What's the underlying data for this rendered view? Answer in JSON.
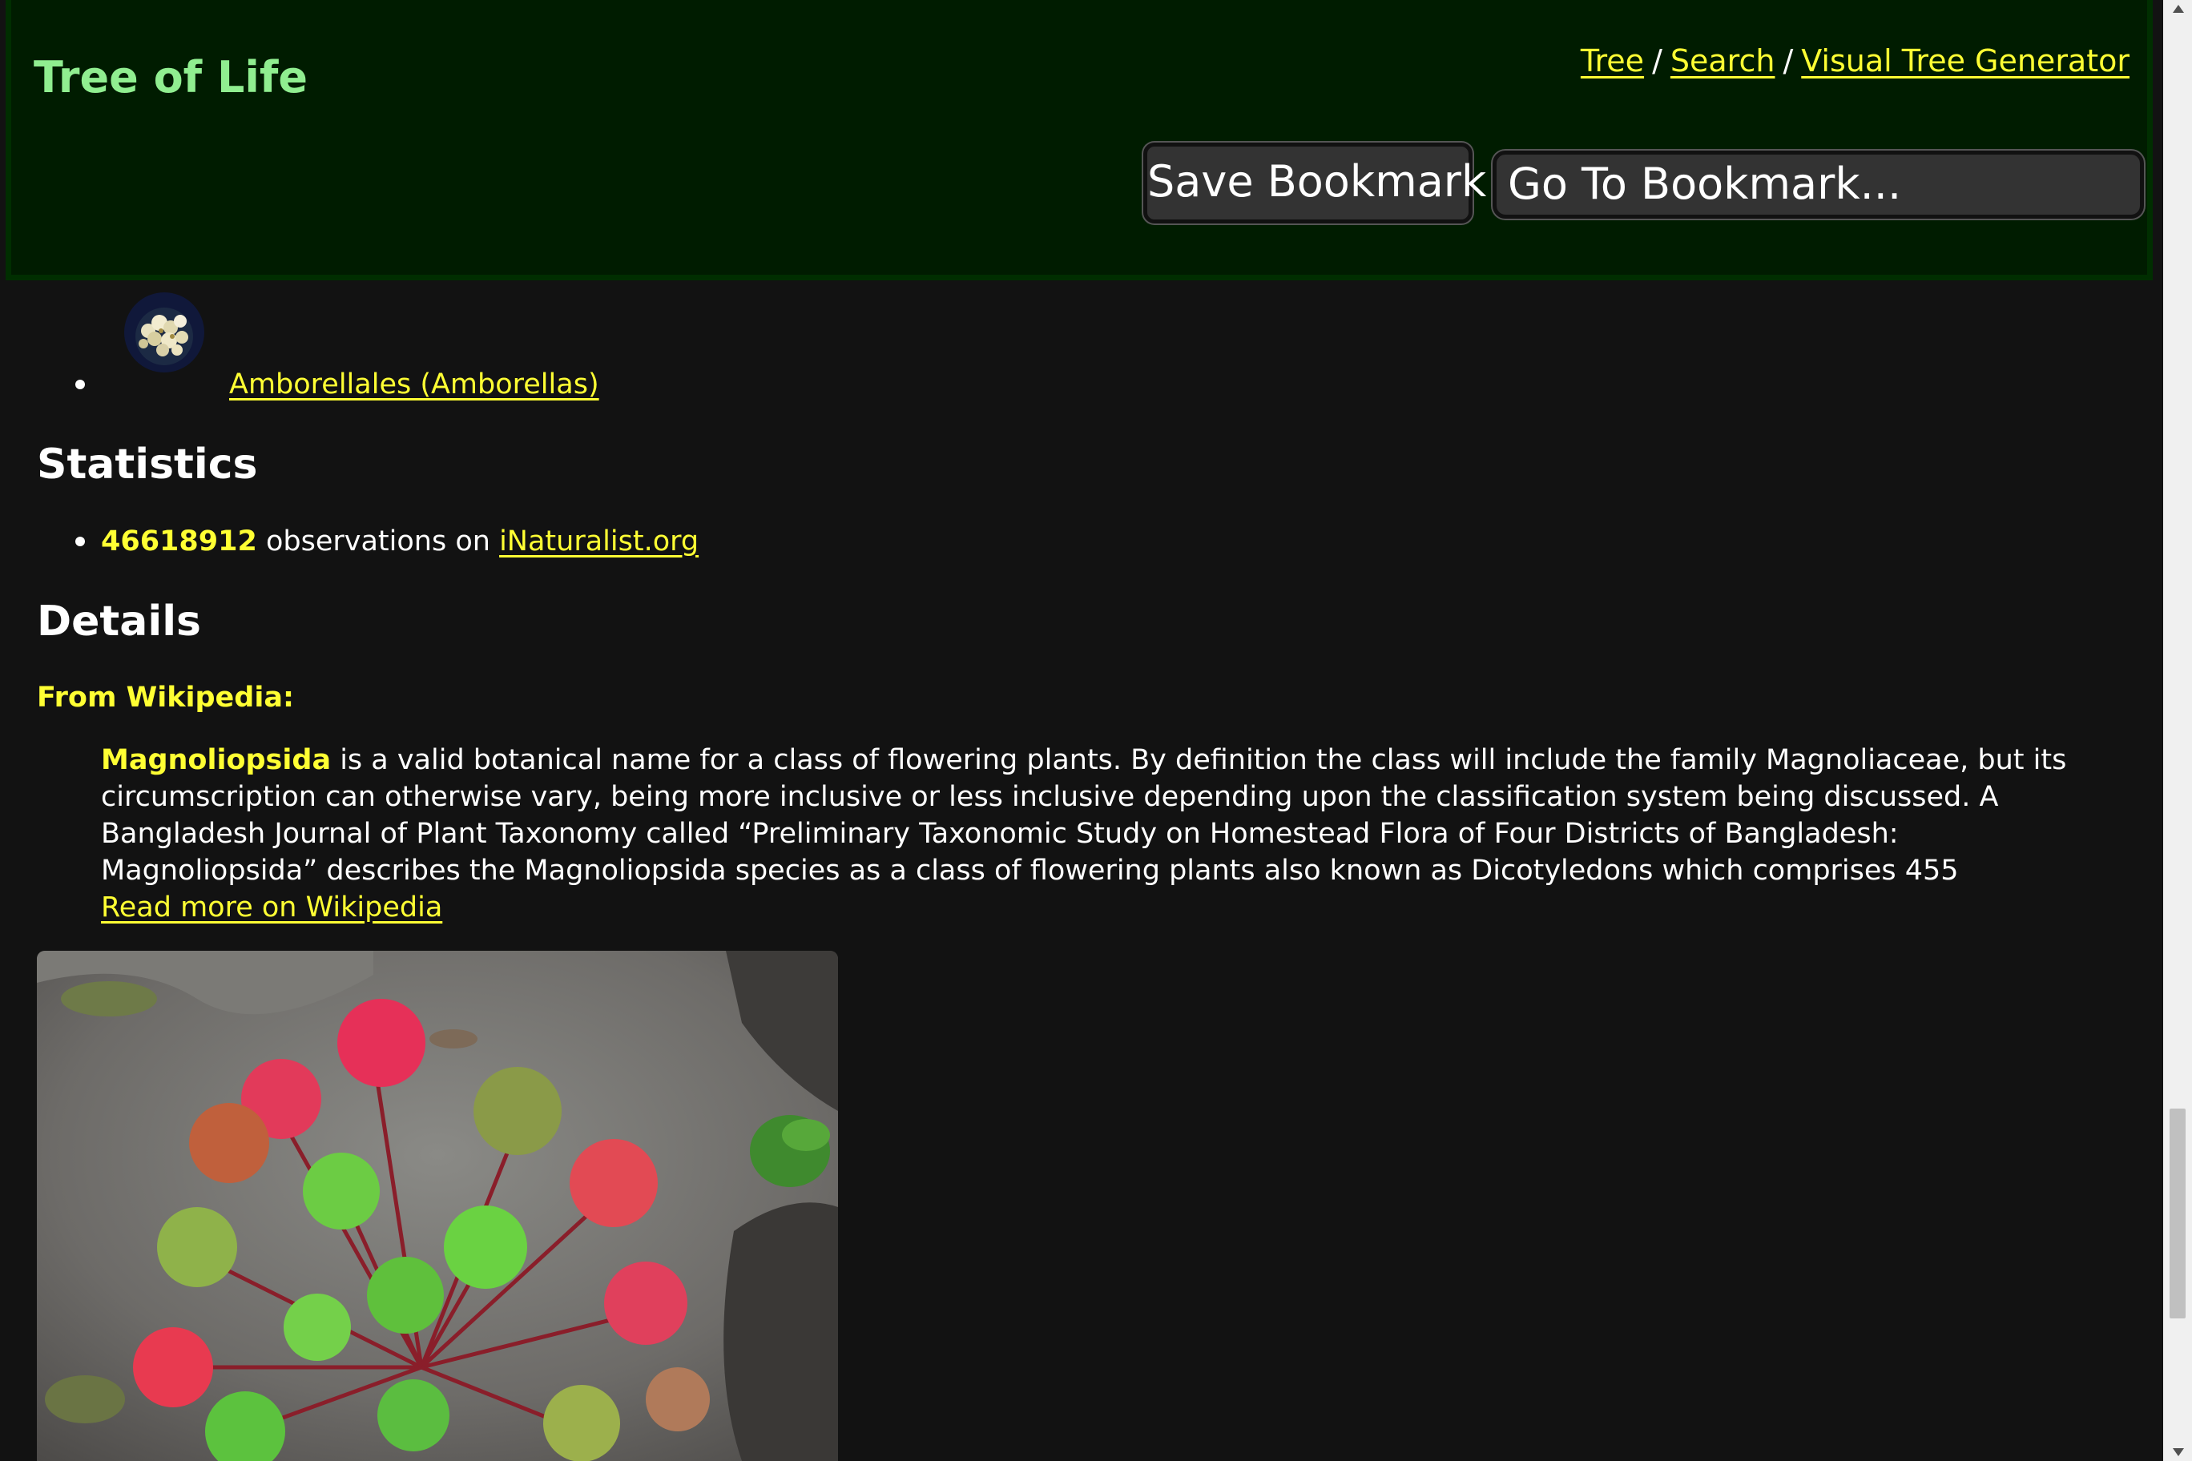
{
  "header": {
    "title": "Tree of Life",
    "nav": {
      "tree": "Tree",
      "search": "Search",
      "visual_tree_generator": "Visual Tree Generator",
      "separator": "/"
    },
    "save_bookmark_label": "Save Bookmark",
    "go_to_bookmark_label": "Go To Bookmark..."
  },
  "children": [
    {
      "label": "Amborellales (Amborellas)",
      "thumb_icon": "flower-cluster-thumbnail"
    }
  ],
  "statistics": {
    "heading": "Statistics",
    "observations_count": "46618912",
    "observations_text": "observations on",
    "source_link": "iNaturalist.org"
  },
  "details": {
    "heading": "Details",
    "from_label": "From Wikipedia:",
    "term": "Magnoliopsida",
    "summary": " is a valid botanical name for a class of flowering plants. By definition the class will include the family Magnoliaceae, but its circumscription can otherwise vary, being more inclusive or less inclusive depending upon the classification system being discussed. A Bangladesh Journal of Plant Taxonomy called “Preliminary Taxonomic Study on Homestead Flora of Four Districts of Bangladesh: Magnoliopsida” describes the Magnoliopsida species as a class of flowering plants also known as Dicotyledons which comprises 455",
    "read_more": "Read more on Wikipedia",
    "photo_icon": "plant-photo"
  },
  "colors": {
    "header_bg": "#001c00",
    "title": "#90ee90",
    "link": "#ffff33",
    "page_bg": "#121212"
  }
}
